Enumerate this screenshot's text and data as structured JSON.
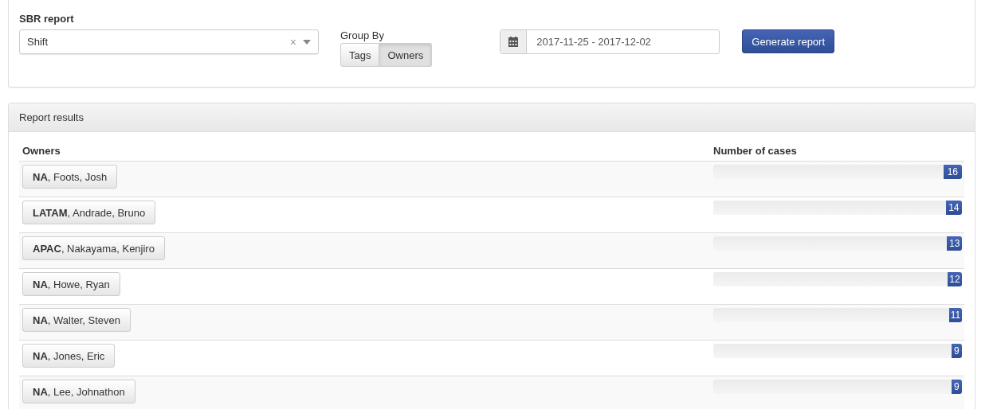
{
  "report_form": {
    "title": "SBR report",
    "report_select": {
      "value": "Shift",
      "clear": "×"
    },
    "group_by": {
      "label": "Group By",
      "options": [
        {
          "label": "Tags",
          "selected": false
        },
        {
          "label": "Owners",
          "selected": true
        }
      ]
    },
    "date_range": {
      "value": "2017-11-25 - 2017-12-02"
    },
    "generate_button": "Generate report"
  },
  "results": {
    "title": "Report results",
    "columns": [
      "Owners",
      "Number of cases"
    ],
    "rows": [
      {
        "owner": "**NA**, Foots, Josh",
        "count": "16",
        "level": 0.075
      },
      {
        "owner": "**LATAM**, Andrade, Bruno",
        "count": "14",
        "level": 0.065
      },
      {
        "owner": "**APAC**, Nakayama, Kenjiro",
        "count": "13",
        "level": 0.06
      },
      {
        "owner": "**NA**, Howe, Ryan",
        "count": "12",
        "level": 0.058
      },
      {
        "owner": "**NA**, Walter, Steven",
        "count": "11",
        "level": 0.052
      },
      {
        "owner": "**NA**, Jones, Eric",
        "count": "9",
        "level": 0.042
      },
      {
        "owner": "**NA**, Lee, Johnathon",
        "count": "9",
        "level": 0.042
      }
    ]
  }
}
